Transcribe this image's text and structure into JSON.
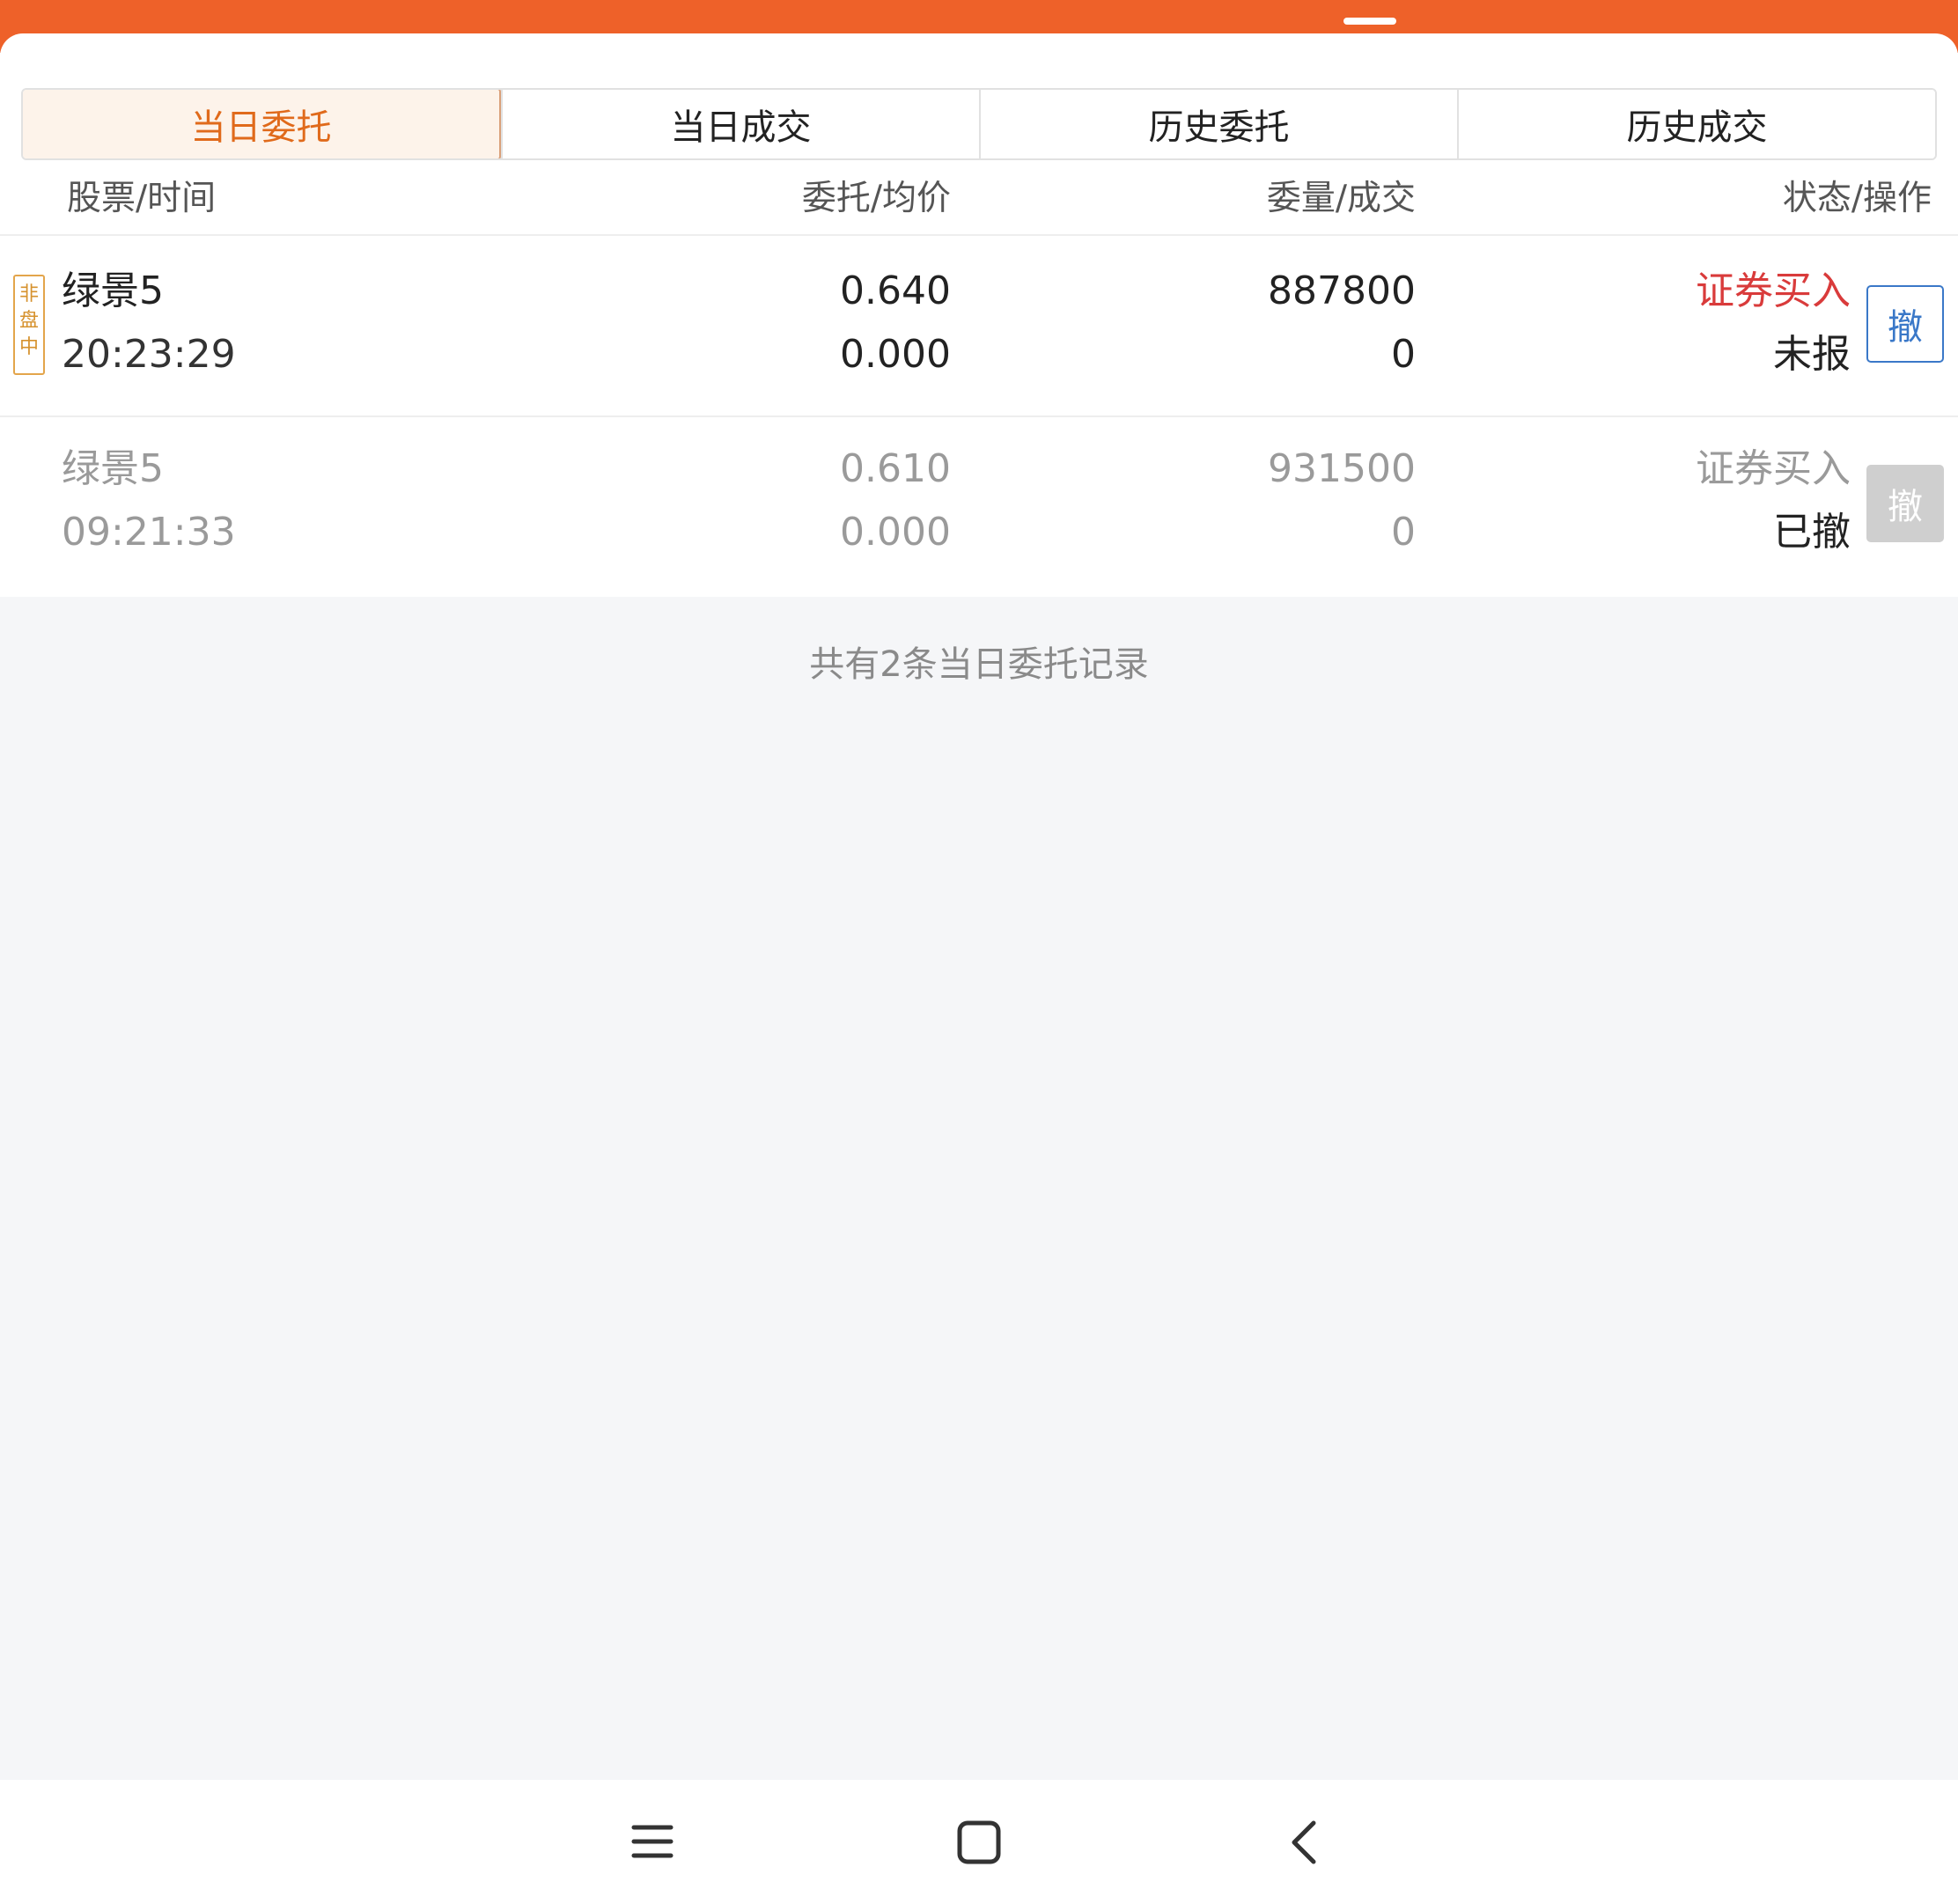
{
  "tabs": [
    {
      "label": "当日委托",
      "active": true
    },
    {
      "label": "当日成交",
      "active": false
    },
    {
      "label": "历史委托",
      "active": false
    },
    {
      "label": "历史成交",
      "active": false
    }
  ],
  "columns": {
    "stock_time": "股票/时间",
    "price": "委托/均价",
    "qty": "委量/成交",
    "status": "状态/操作"
  },
  "orders": [
    {
      "badge": "非盘中",
      "name": "绿景5",
      "time": "20:23:29",
      "price": "0.640",
      "avg_price": "0.000",
      "qty": "887800",
      "filled": "0",
      "side": "证券买入",
      "status": "未报",
      "cancel_label": "撤"
    },
    {
      "name": "绿景5",
      "time": "09:21:33",
      "price": "0.610",
      "avg_price": "0.000",
      "qty": "931500",
      "filled": "0",
      "side": "证券买入",
      "status": "已撤",
      "cancel_label": "撤"
    }
  ],
  "summary": "共有2条当日委托记录",
  "colors": {
    "brand": "#ee6129",
    "active_tab_text": "#e06a1b",
    "buy_red": "#d93b3b",
    "cancel_blue": "#3a78c8",
    "muted_gray": "#9a9a9a"
  },
  "nav_icons": [
    "menu-icon",
    "home-square-icon",
    "back-chevron-icon"
  ]
}
